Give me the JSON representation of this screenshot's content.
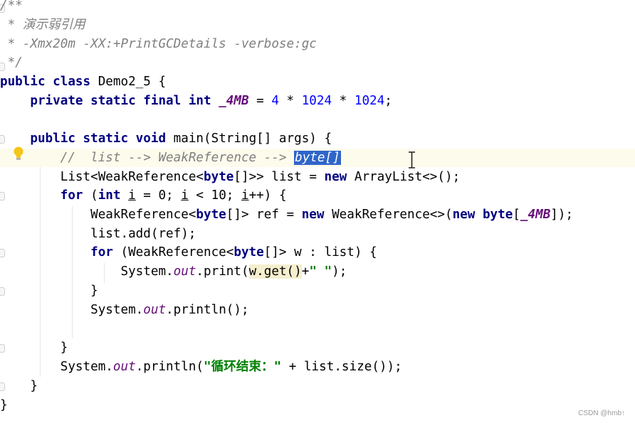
{
  "code": {
    "l1": "/**",
    "l2_prefix": " * ",
    "l2_text": "演示弱引用",
    "l3": " * -Xmx20m -XX:+PrintGCDetails -verbose:gc",
    "l4": " */",
    "l5_kw": "public class",
    "l5_rest": " Demo2_5 {",
    "l6_indent": "    ",
    "l6_kw": "private static final int",
    "l6_sp": " ",
    "l6_field": "_4MB",
    "l6_rest": " = ",
    "l6_n1": "4",
    "l6_op": " * ",
    "l6_n2": "1024",
    "l6_op2": " * ",
    "l6_n3": "1024",
    "l6_end": ";",
    "l8_indent": "    ",
    "l8_kw": "public static void",
    "l8_rest": " main(String[] args) {",
    "l9_indent": "        ",
    "l9_comment": "//  list --> WeakReference --> ",
    "l9_selected": "byte[]",
    "l10_indent": "        ",
    "l10_a": "List<WeakReference<",
    "l10_kw": "byte",
    "l10_b": "[]>> list = ",
    "l10_kw2": "new",
    "l10_c": " ArrayList<>();",
    "l11_indent": "        ",
    "l11_kw": "for",
    "l11_a": " (",
    "l11_kw2": "int",
    "l11_sp": " ",
    "l11_i1": "i",
    "l11_b": " = 0; ",
    "l11_i2": "i",
    "l11_c": " < 10; ",
    "l11_i3": "i",
    "l11_d": "++) {",
    "l12_indent": "            ",
    "l12_a": "WeakReference<",
    "l12_kw": "byte",
    "l12_b": "[]> ref = ",
    "l12_kw2": "new",
    "l12_c": " WeakReference<>(",
    "l12_kw3": "new byte",
    "l12_d": "[",
    "l12_field": "_4MB",
    "l12_e": "]);",
    "l13": "            list.add(ref);",
    "l14_indent": "            ",
    "l14_kw": "for",
    "l14_a": " (WeakReference<",
    "l14_kw2": "byte",
    "l14_b": "[]> w : list) {",
    "l15_indent": "                ",
    "l15_a": "System.",
    "l15_out": "out",
    "l15_b": ".print(",
    "l15_hl": "w.get()",
    "l15_c": "+",
    "l15_str": "\" \"",
    "l15_d": ");",
    "l16": "            }",
    "l17_indent": "            ",
    "l17_a": "System.",
    "l17_out": "out",
    "l17_b": ".println();",
    "l19": "        }",
    "l20_indent": "        ",
    "l20_a": "System.",
    "l20_out": "out",
    "l20_b": ".println(",
    "l20_str": "\"循环结束：\"",
    "l20_c": " + list.size());",
    "l21": "    }",
    "l22": "}"
  },
  "watermark": "CSDN @hmb↑",
  "colors": {
    "keyword": "#000080",
    "comment": "#808080",
    "field": "#660e7a",
    "string": "#008000",
    "selection": "#2f65ca",
    "caret_row": "#fdfbec",
    "usage_highlight": "#f5eecf"
  },
  "icons": {
    "bulb": "lightbulb-icon",
    "cursor": "text-cursor-icon"
  }
}
